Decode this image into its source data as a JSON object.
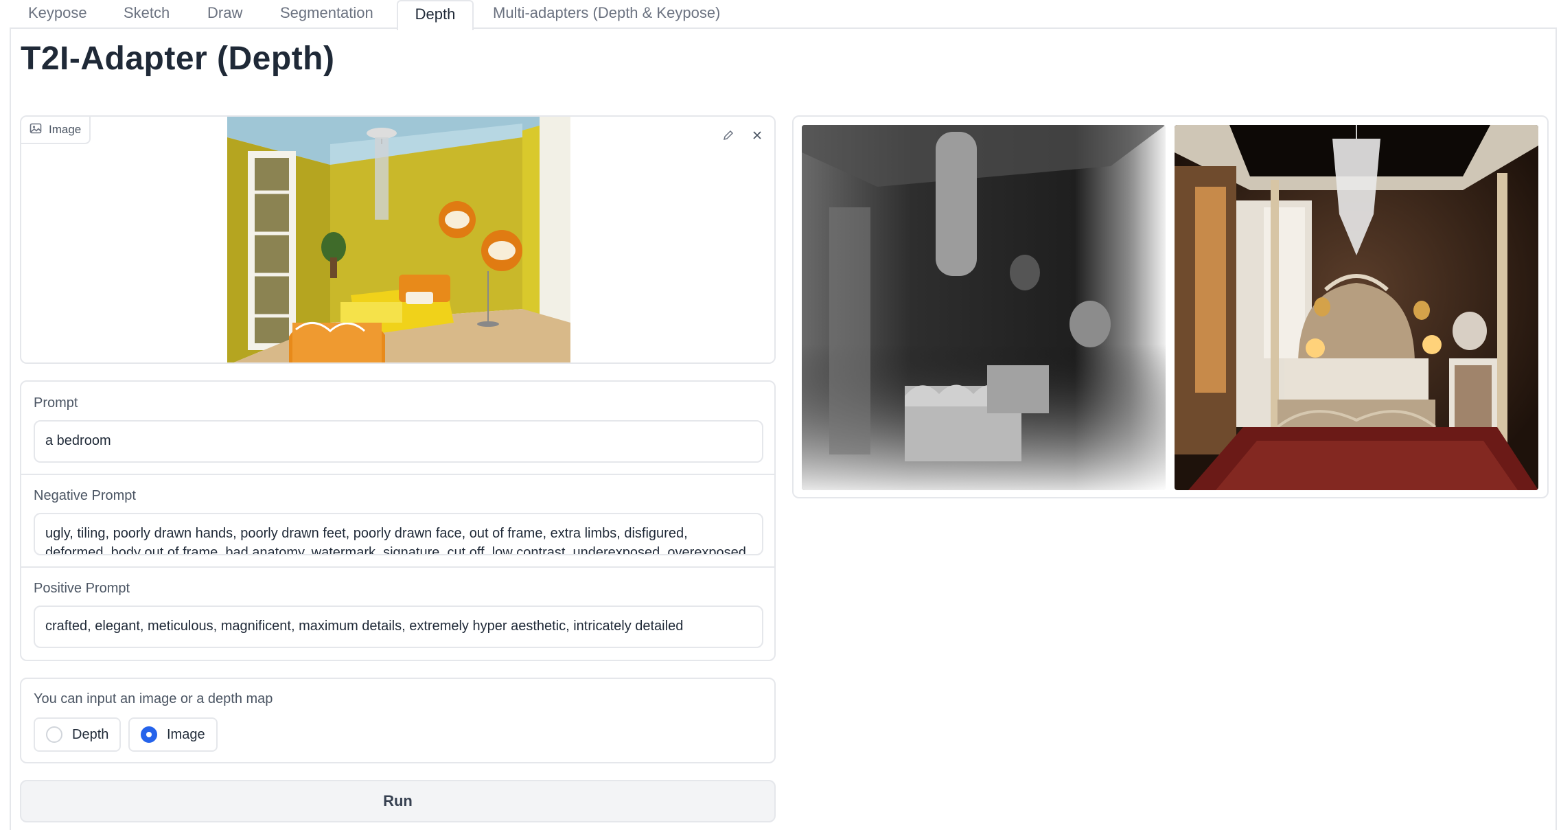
{
  "tabs": [
    {
      "label": "Keypose"
    },
    {
      "label": "Sketch"
    },
    {
      "label": "Draw"
    },
    {
      "label": "Segmentation"
    },
    {
      "label": "Depth",
      "active": true
    },
    {
      "label": "Multi-adapters (Depth & Keypose)"
    }
  ],
  "page_title": "T2I-Adapter (Depth)",
  "image_input": {
    "label": "Image",
    "icon": "image-icon",
    "tools": [
      "edit-icon",
      "close-icon"
    ]
  },
  "prompt": {
    "label": "Prompt",
    "value": "a bedroom"
  },
  "negative_prompt": {
    "label": "Negative Prompt",
    "value": "ugly, tiling, poorly drawn hands, poorly drawn feet, poorly drawn face, out of frame, extra limbs, disfigured, deformed, body out of frame, bad anatomy, watermark, signature, cut off, low contrast, underexposed, overexposed, bad art"
  },
  "positive_prompt": {
    "label": "Positive Prompt",
    "value": "crafted, elegant, meticulous, magnificent, maximum details, extremely hyper aesthetic, intricately detailed"
  },
  "input_type": {
    "label": "You can input an image or a depth map",
    "options": [
      {
        "label": "Depth",
        "checked": false
      },
      {
        "label": "Image",
        "checked": true
      }
    ]
  },
  "run_button": {
    "label": "Run"
  },
  "colors": {
    "accent": "#2563eb",
    "border": "#e5e7eb",
    "button_bg": "#f3f4f6"
  }
}
